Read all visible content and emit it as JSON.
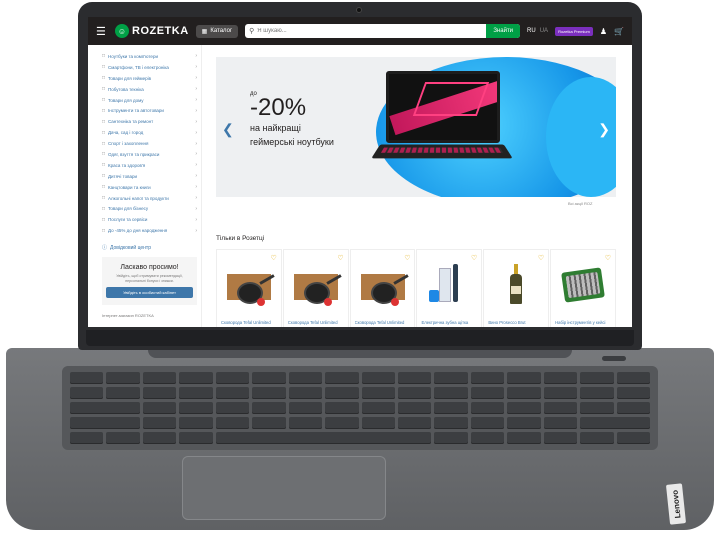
{
  "header": {
    "logo_text": "ROZETKA",
    "catalog_label": "Каталог",
    "search_placeholder": "Я шукаю...",
    "search_button": "Знайти",
    "lang_active": "RU",
    "lang_inactive": "UA",
    "premium_label": "Rozetka Premium"
  },
  "sidebar": {
    "categories": [
      "Ноутбуки та комп'ютери",
      "Смартфони, ТВ і електроніка",
      "Товари для геймерів",
      "Побутова техніка",
      "Товари для дому",
      "Інструменти та автотовари",
      "Сантехніка та ремонт",
      "Дача, сад і город",
      "Спорт і захоплення",
      "Одяг, взуття та прикраси",
      "Краса та здоров'я",
      "Дитячі товари",
      "Канцтовари та книги",
      "Алкогольні напої та продукти",
      "Товари для бізнесу",
      "Послуги та сервіси",
      "До -45% до дня народження"
    ],
    "help_label": "Довідковий центр",
    "welcome_title": "Ласкаво просимо!",
    "welcome_text": "Увійдіть, щоб отримувати рекомендації, персональні бонуси і знижки.",
    "login_button": "Увійдіть в особистий кабінет",
    "footer_text": "Інтернет-магазин ROZETKA"
  },
  "banner": {
    "prefix": "до",
    "discount": "-20%",
    "line1": "на найкращі",
    "line2": "геймерські ноутбуки",
    "legal": "Всі акції ROZ"
  },
  "products": {
    "title": "Тільки в Розетці",
    "items": [
      "Сковорода Tefal Unlimited",
      "Сковорода Tefal Unlimited",
      "Сковорода Tefal Unlimited",
      "Електрична зубна щітка",
      "Вино Prosecco Brut",
      "Набір інструментів у кейсі"
    ]
  },
  "laptop": {
    "brand": "Lenovo"
  }
}
